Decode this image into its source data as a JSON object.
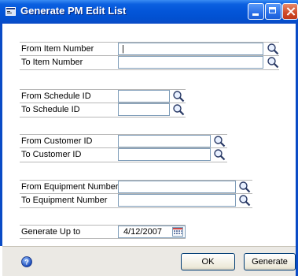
{
  "window": {
    "title": "Generate PM Edit List"
  },
  "fields": [
    {
      "label": "From Item Number",
      "value": "|"
    },
    {
      "label": "To Item Number",
      "value": ""
    },
    {
      "label": "From Schedule ID",
      "value": ""
    },
    {
      "label": "To Schedule ID",
      "value": ""
    },
    {
      "label": "From Customer ID",
      "value": ""
    },
    {
      "label": "To Customer ID",
      "value": ""
    },
    {
      "label": "From Equipment Number",
      "value": ""
    },
    {
      "label": "To Equipment Number",
      "value": ""
    }
  ],
  "generate_up_to": {
    "label": "Generate Up to",
    "value": "4/12/2007"
  },
  "buttons": {
    "ok": "OK",
    "generate": "Generate"
  },
  "icons": {
    "lookup": "magnifier-icon",
    "calendar": "calendar-icon",
    "help": "help-icon"
  },
  "colors": {
    "titlebar": "#0355d8",
    "footer": "#ebe9e4",
    "field_border": "#7f9db9"
  }
}
